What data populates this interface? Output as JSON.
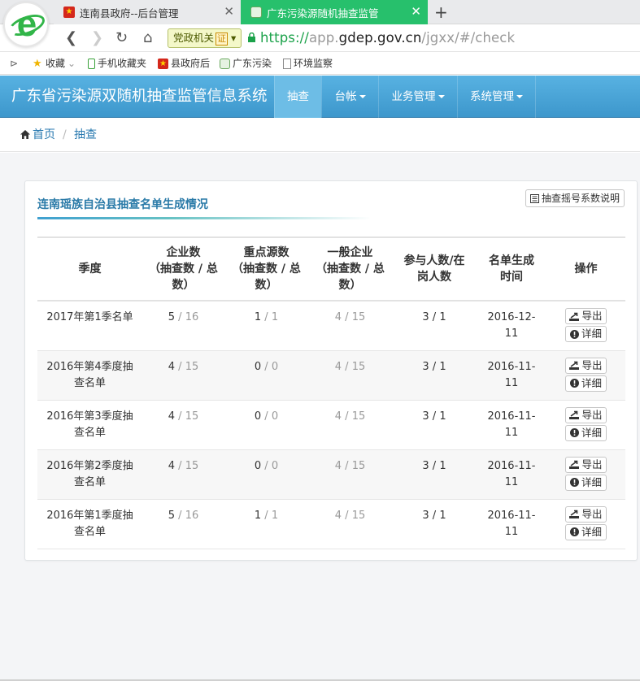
{
  "browser": {
    "tabs": [
      {
        "title": "连南县政府--后台管理",
        "active": false
      },
      {
        "title": "广东污染源随机抽查监管",
        "active": true
      }
    ],
    "party_badge": "党政机关",
    "party_cert": "证",
    "url_scheme": "https://",
    "url_host_prefix": "app.",
    "url_host": "gdep.gov.cn",
    "url_path": "/jgxx/#/check",
    "bookmarks": [
      "收藏",
      "手机收藏夹",
      "县政府后",
      "广东污染",
      "环境监察"
    ]
  },
  "app": {
    "title": "广东省污染源双随机抽查监管信息系统",
    "nav": [
      {
        "label": "抽查",
        "active": true,
        "dropdown": false
      },
      {
        "label": "台帐",
        "active": false,
        "dropdown": true
      },
      {
        "label": "业务管理",
        "active": false,
        "dropdown": true
      },
      {
        "label": "系统管理",
        "active": false,
        "dropdown": true
      }
    ],
    "accent_color": "#4aa3d6"
  },
  "breadcrumb": {
    "home": "首页",
    "separator": "/",
    "current": "抽查"
  },
  "panel": {
    "title": "连南瑶族自治县抽查名单生成情况",
    "explain_button": "抽查摇号系数说明",
    "columns": [
      "季度",
      "企业数（抽查数 / 总数）",
      "重点源数（抽查数 / 总数）",
      "一般企业（抽查数 / 总数）",
      "参与人数/在岗人数",
      "名单生成时间",
      "操作"
    ],
    "column_lines": [
      [
        "季度"
      ],
      [
        "企业数",
        "（抽查数 / 总",
        "数）"
      ],
      [
        "重点源数",
        "（抽查数 / 总",
        "数）"
      ],
      [
        "一般企业",
        "（抽查数 / 总",
        "数）"
      ],
      [
        "参与人数/在",
        "岗人数"
      ],
      [
        "名单生成",
        "时间"
      ],
      [
        "操作"
      ]
    ],
    "export_label": "导出",
    "detail_label": "详细",
    "rows": [
      {
        "name_l1": "2017年第1季名单",
        "name_l2": "",
        "ent_a": "5",
        "ent_b": "16",
        "key_a": "1",
        "key_b": "1",
        "gen_a": "4",
        "gen_b": "15",
        "people": "3 / 1",
        "date_l1": "2016-12-",
        "date_l2": "11"
      },
      {
        "name_l1": "2016年第4季度抽",
        "name_l2": "查名单",
        "ent_a": "4",
        "ent_b": "15",
        "key_a": "0",
        "key_b": "0",
        "gen_a": "4",
        "gen_b": "15",
        "people": "3 / 1",
        "date_l1": "2016-11-",
        "date_l2": "11"
      },
      {
        "name_l1": "2016年第3季度抽",
        "name_l2": "查名单",
        "ent_a": "4",
        "ent_b": "15",
        "key_a": "0",
        "key_b": "0",
        "gen_a": "4",
        "gen_b": "15",
        "people": "3 / 1",
        "date_l1": "2016-11-",
        "date_l2": "11"
      },
      {
        "name_l1": "2016年第2季度抽",
        "name_l2": "查名单",
        "ent_a": "4",
        "ent_b": "15",
        "key_a": "0",
        "key_b": "0",
        "gen_a": "4",
        "gen_b": "15",
        "people": "3 / 1",
        "date_l1": "2016-11-",
        "date_l2": "11"
      },
      {
        "name_l1": "2016年第1季度抽",
        "name_l2": "查名单",
        "ent_a": "5",
        "ent_b": "16",
        "key_a": "1",
        "key_b": "1",
        "gen_a": "4",
        "gen_b": "15",
        "people": "3 / 1",
        "date_l1": "2016-11-",
        "date_l2": "11"
      }
    ]
  }
}
